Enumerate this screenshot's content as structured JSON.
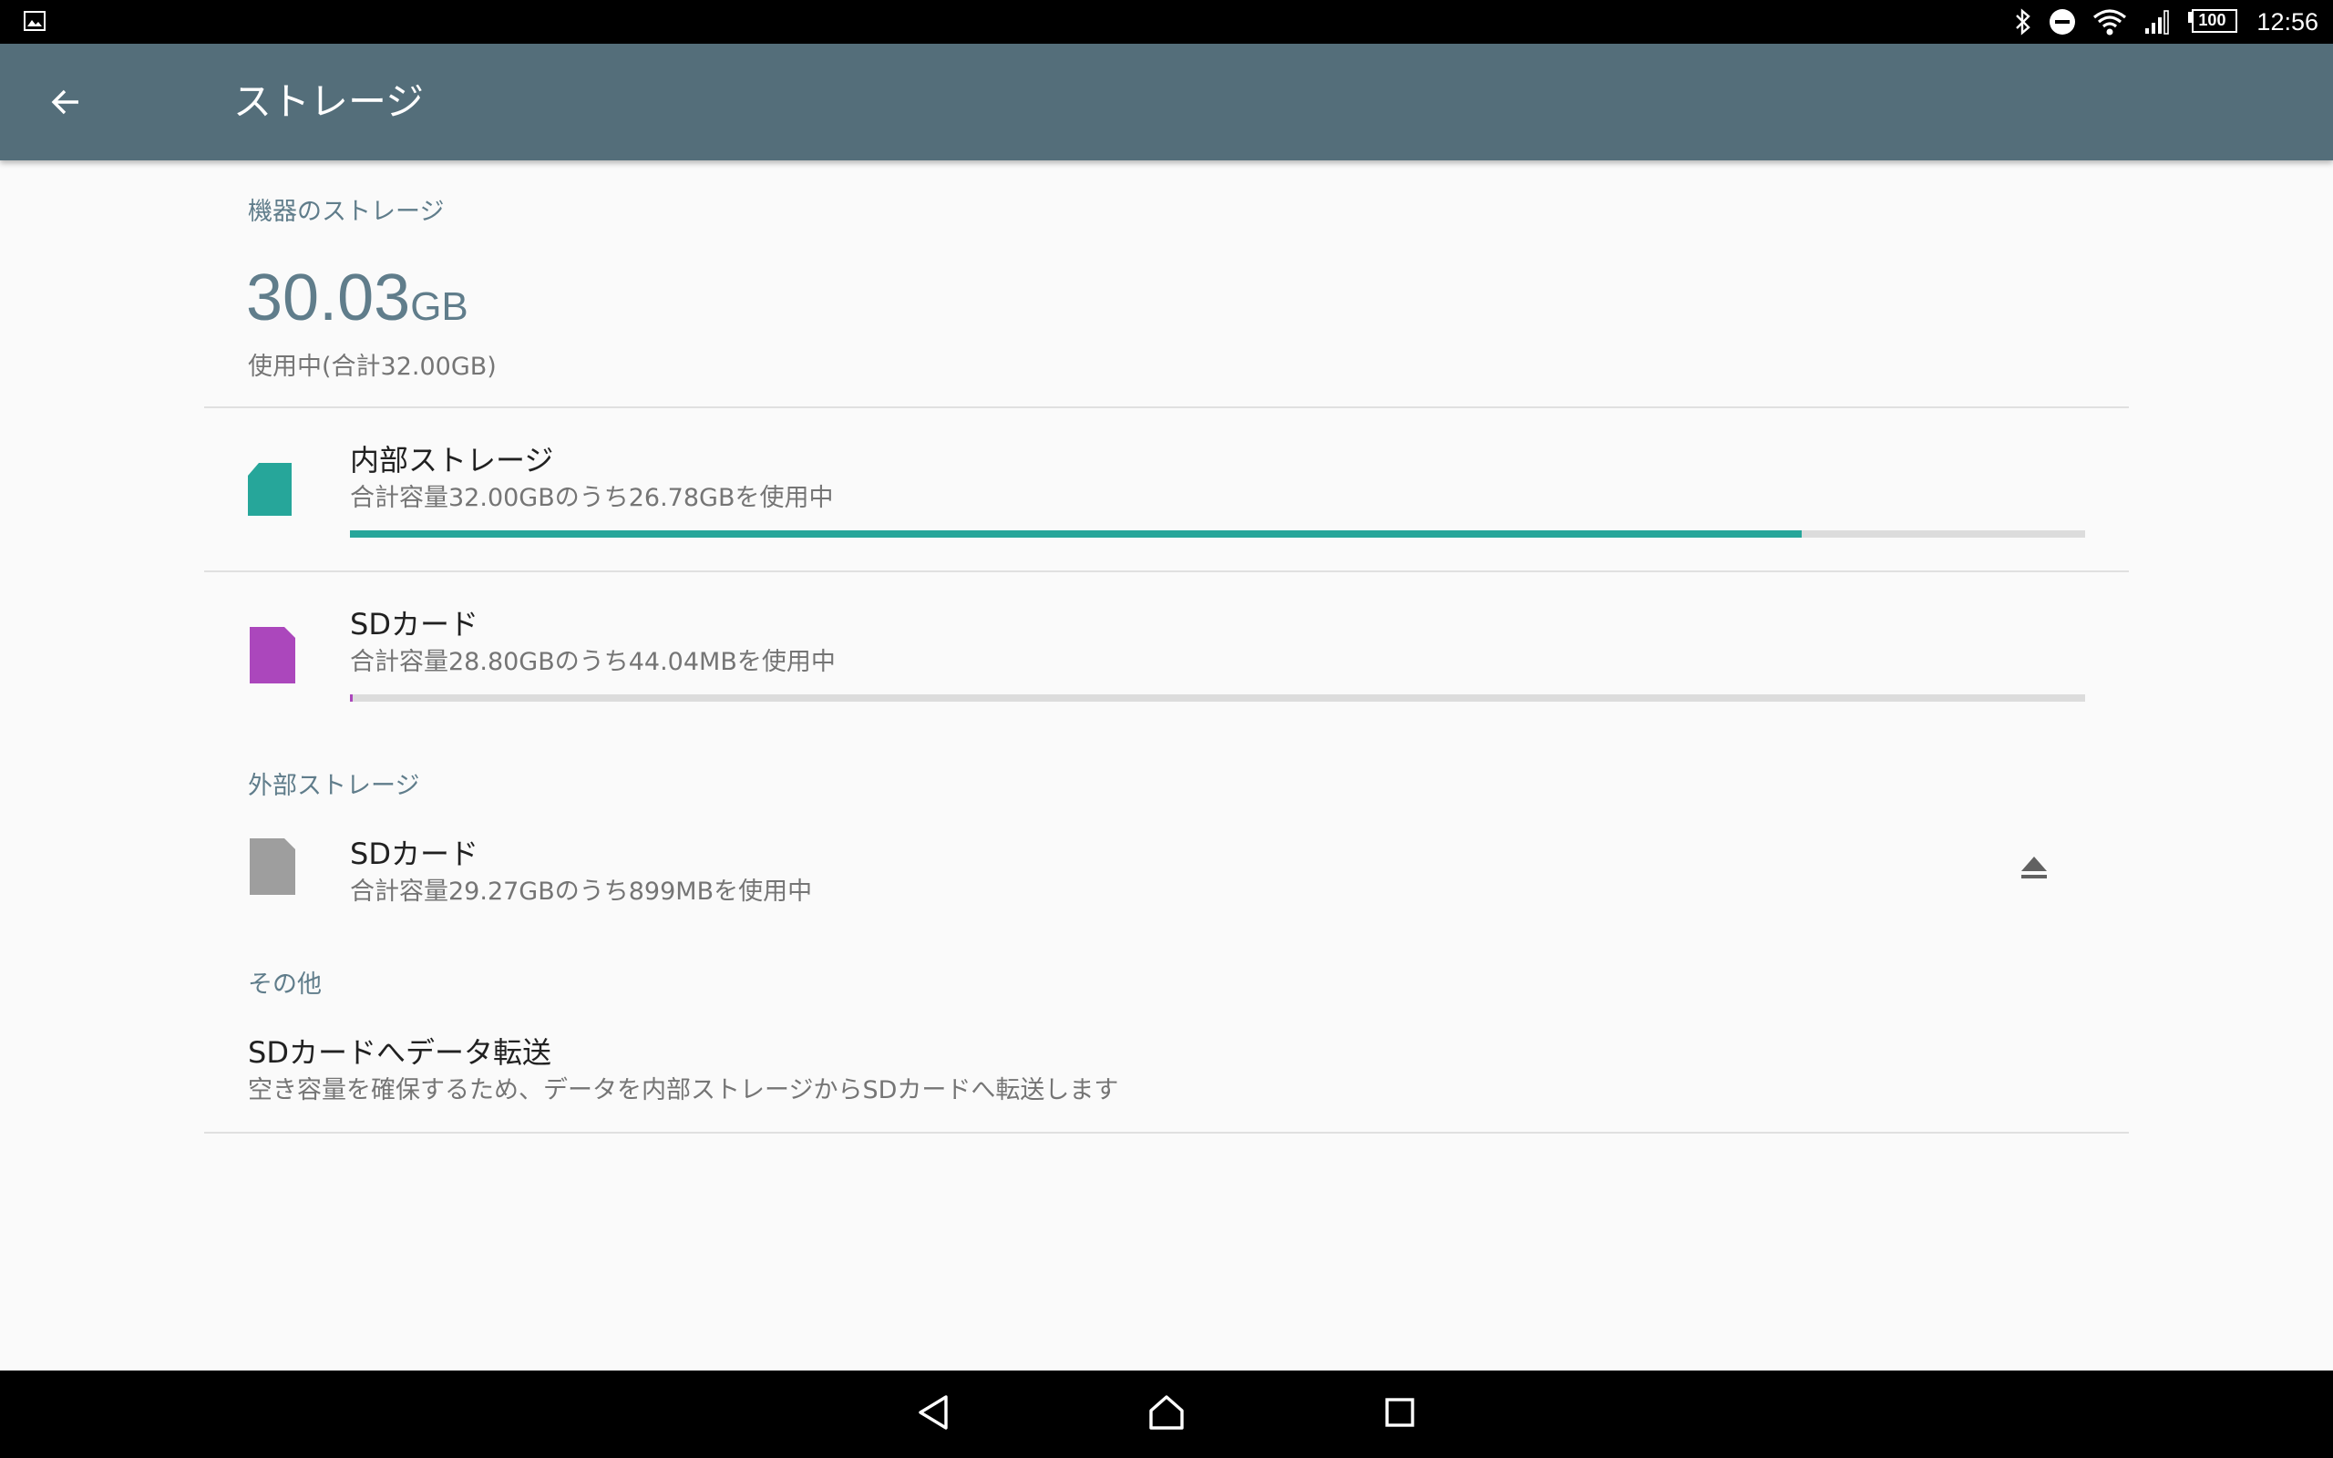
{
  "status_bar": {
    "time": "12:56",
    "battery": "100",
    "icons": [
      "image-notification-icon",
      "bluetooth-icon",
      "do-not-disturb-icon",
      "wifi-icon",
      "cellular-signal-icon",
      "battery-icon"
    ]
  },
  "app_bar": {
    "title": "ストレージ",
    "back_icon": "arrow-back-icon"
  },
  "device_storage": {
    "header": "機器のストレージ",
    "used_value": "30.03",
    "used_unit": "GB",
    "used_caption": "使用中(合計32.00GB)",
    "volumes": [
      {
        "title": "内部ストレージ",
        "subtitle": "合計容量32.00GBのうち26.78GBを使用中",
        "icon": "internal-storage-icon",
        "icon_color": "#26a69a",
        "usage_fraction": 0.8369
      },
      {
        "title": "SDカード",
        "subtitle": "合計容量28.80GBのうち44.04MBを使用中",
        "icon": "sd-card-icon",
        "icon_color": "#ab47bc",
        "usage_fraction": 0.0015
      }
    ]
  },
  "external_storage": {
    "header": "外部ストレージ",
    "title": "SDカード",
    "subtitle": "合計容量29.27GBのうち899MBを使用中",
    "icon": "sd-card-icon",
    "icon_color": "#9e9e9e",
    "action_icon": "eject-icon"
  },
  "other": {
    "header": "その他",
    "title": "SDカードへデータ転送",
    "subtitle": "空き容量を確保するため、データを内部ストレージからSDカードへ転送します"
  },
  "nav_bar": {
    "icons": [
      "back-nav-icon",
      "home-nav-icon",
      "recents-nav-icon"
    ]
  }
}
